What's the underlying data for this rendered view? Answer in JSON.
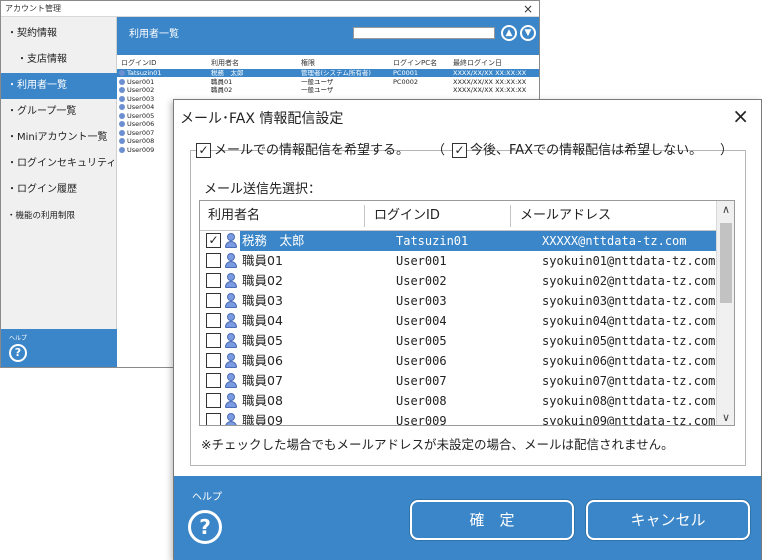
{
  "main_window": {
    "title": "アカウント管理",
    "close": "×",
    "sidebar": [
      {
        "label": "・契約情報",
        "active": false
      },
      {
        "label": "・支店情報",
        "active": false,
        "indent": true
      },
      {
        "label": "・利用者一覧",
        "active": true
      },
      {
        "label": "・グループ一覧",
        "active": false
      },
      {
        "label": "・Miniアカウント一覧",
        "active": false
      },
      {
        "label": "・ログインセキュリティ",
        "active": false
      },
      {
        "label": "・ログイン履歴",
        "active": false
      },
      {
        "label": "・機能の利用制限",
        "active": false
      }
    ],
    "help_label": "ヘルプ",
    "help_icon": "?",
    "header_title": "利用者一覧",
    "nav_up": "▲",
    "nav_down": "▼",
    "columns": [
      "ログインID",
      "利用者名",
      "権限",
      "ログインPC名",
      "最終ログイン日"
    ],
    "rows": [
      [
        "Tatsuzin01",
        "税務　太郎",
        "管理者(システム所有者)",
        "PC0001",
        "XXXX/XX/XX XX:XX:XX"
      ],
      [
        "User001",
        "職員01",
        "一般ユーザ",
        "PC0002",
        "XXXX/XX/XX XX:XX:XX"
      ],
      [
        "User002",
        "職員02",
        "一般ユーザ",
        "",
        "XXXX/XX/XX XX:XX:XX"
      ],
      [
        "User003",
        "",
        "",
        "",
        ""
      ],
      [
        "User004",
        "",
        "",
        "",
        ""
      ],
      [
        "User005",
        "",
        "",
        "",
        ""
      ],
      [
        "User006",
        "",
        "",
        "",
        ""
      ],
      [
        "User007",
        "",
        "",
        "",
        ""
      ],
      [
        "User008",
        "",
        "",
        "",
        ""
      ],
      [
        "User009",
        "",
        "",
        "",
        ""
      ]
    ]
  },
  "dialog": {
    "title": "メール･FAX 情報配信設定",
    "close": "×",
    "opt_mail_label": "メールでの情報配信を希望する。",
    "opt_mail_checked": true,
    "paren_open": "（",
    "opt_fax_label": "今後、FAXでの情報配信は希望しない。",
    "opt_fax_checked": true,
    "paren_close": "）",
    "mail_target_label": "メール送信先選択：",
    "columns": [
      "利用者名",
      "ログインID",
      "メールアドレス"
    ],
    "rows": [
      {
        "checked": true,
        "name": "税務　太郎",
        "login": "Tatsuzin01",
        "mail": "XXXXX@nttdata-tz.com",
        "selected": true
      },
      {
        "checked": false,
        "name": "職員01",
        "login": "User001",
        "mail": "syokuin01@nttdata-tz.com"
      },
      {
        "checked": false,
        "name": "職員02",
        "login": "User002",
        "mail": "syokuin02@nttdata-tz.com"
      },
      {
        "checked": false,
        "name": "職員03",
        "login": "User003",
        "mail": "syokuin03@nttdata-tz.com"
      },
      {
        "checked": false,
        "name": "職員04",
        "login": "User004",
        "mail": "syokuin04@nttdata-tz.com"
      },
      {
        "checked": false,
        "name": "職員05",
        "login": "User005",
        "mail": "syokuin05@nttdata-tz.com"
      },
      {
        "checked": false,
        "name": "職員06",
        "login": "User006",
        "mail": "syokuin06@nttdata-tz.com"
      },
      {
        "checked": false,
        "name": "職員07",
        "login": "User007",
        "mail": "syokuin07@nttdata-tz.com"
      },
      {
        "checked": false,
        "name": "職員08",
        "login": "User008",
        "mail": "syokuin08@nttdata-tz.com"
      },
      {
        "checked": false,
        "name": "職員09",
        "login": "User009",
        "mail": "syokuin09@nttdata-tz.com"
      }
    ],
    "scroll_up": "∧",
    "scroll_down": "∨",
    "note": "※チェックした場合でもメールアドレスが未設定の場合、メールは配信されません。",
    "help_label": "ヘルプ",
    "help_icon": "?",
    "ok_label": "確　定",
    "cancel_label": "キャンセル"
  },
  "colors": {
    "accent": "#3b86c8",
    "user_icon": "#7b9be0"
  },
  "icons": {
    "user": "user-icon",
    "help": "help-icon",
    "close": "close-icon",
    "checkbox": "checkbox-icon"
  }
}
